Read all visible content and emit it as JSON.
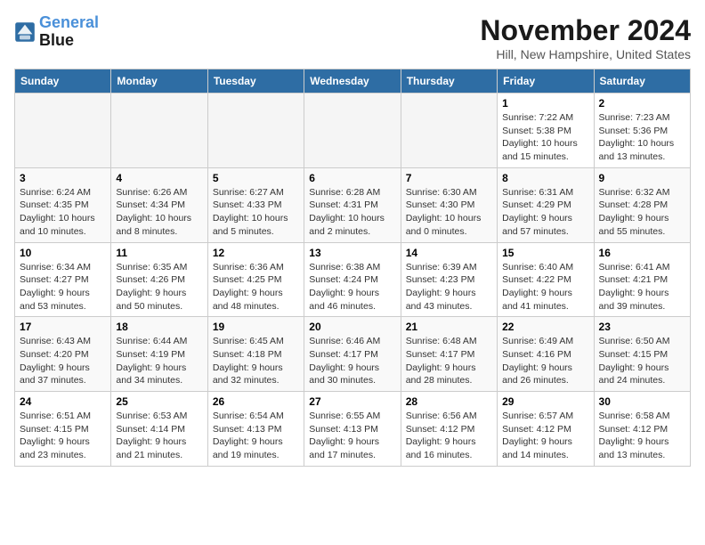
{
  "header": {
    "logo_line1": "General",
    "logo_line2": "Blue",
    "month": "November 2024",
    "location": "Hill, New Hampshire, United States"
  },
  "weekdays": [
    "Sunday",
    "Monday",
    "Tuesday",
    "Wednesday",
    "Thursday",
    "Friday",
    "Saturday"
  ],
  "weeks": [
    [
      {
        "day": "",
        "info": ""
      },
      {
        "day": "",
        "info": ""
      },
      {
        "day": "",
        "info": ""
      },
      {
        "day": "",
        "info": ""
      },
      {
        "day": "",
        "info": ""
      },
      {
        "day": "1",
        "info": "Sunrise: 7:22 AM\nSunset: 5:38 PM\nDaylight: 10 hours\nand 15 minutes."
      },
      {
        "day": "2",
        "info": "Sunrise: 7:23 AM\nSunset: 5:36 PM\nDaylight: 10 hours\nand 13 minutes."
      }
    ],
    [
      {
        "day": "3",
        "info": "Sunrise: 6:24 AM\nSunset: 4:35 PM\nDaylight: 10 hours\nand 10 minutes."
      },
      {
        "day": "4",
        "info": "Sunrise: 6:26 AM\nSunset: 4:34 PM\nDaylight: 10 hours\nand 8 minutes."
      },
      {
        "day": "5",
        "info": "Sunrise: 6:27 AM\nSunset: 4:33 PM\nDaylight: 10 hours\nand 5 minutes."
      },
      {
        "day": "6",
        "info": "Sunrise: 6:28 AM\nSunset: 4:31 PM\nDaylight: 10 hours\nand 2 minutes."
      },
      {
        "day": "7",
        "info": "Sunrise: 6:30 AM\nSunset: 4:30 PM\nDaylight: 10 hours\nand 0 minutes."
      },
      {
        "day": "8",
        "info": "Sunrise: 6:31 AM\nSunset: 4:29 PM\nDaylight: 9 hours\nand 57 minutes."
      },
      {
        "day": "9",
        "info": "Sunrise: 6:32 AM\nSunset: 4:28 PM\nDaylight: 9 hours\nand 55 minutes."
      }
    ],
    [
      {
        "day": "10",
        "info": "Sunrise: 6:34 AM\nSunset: 4:27 PM\nDaylight: 9 hours\nand 53 minutes."
      },
      {
        "day": "11",
        "info": "Sunrise: 6:35 AM\nSunset: 4:26 PM\nDaylight: 9 hours\nand 50 minutes."
      },
      {
        "day": "12",
        "info": "Sunrise: 6:36 AM\nSunset: 4:25 PM\nDaylight: 9 hours\nand 48 minutes."
      },
      {
        "day": "13",
        "info": "Sunrise: 6:38 AM\nSunset: 4:24 PM\nDaylight: 9 hours\nand 46 minutes."
      },
      {
        "day": "14",
        "info": "Sunrise: 6:39 AM\nSunset: 4:23 PM\nDaylight: 9 hours\nand 43 minutes."
      },
      {
        "day": "15",
        "info": "Sunrise: 6:40 AM\nSunset: 4:22 PM\nDaylight: 9 hours\nand 41 minutes."
      },
      {
        "day": "16",
        "info": "Sunrise: 6:41 AM\nSunset: 4:21 PM\nDaylight: 9 hours\nand 39 minutes."
      }
    ],
    [
      {
        "day": "17",
        "info": "Sunrise: 6:43 AM\nSunset: 4:20 PM\nDaylight: 9 hours\nand 37 minutes."
      },
      {
        "day": "18",
        "info": "Sunrise: 6:44 AM\nSunset: 4:19 PM\nDaylight: 9 hours\nand 34 minutes."
      },
      {
        "day": "19",
        "info": "Sunrise: 6:45 AM\nSunset: 4:18 PM\nDaylight: 9 hours\nand 32 minutes."
      },
      {
        "day": "20",
        "info": "Sunrise: 6:46 AM\nSunset: 4:17 PM\nDaylight: 9 hours\nand 30 minutes."
      },
      {
        "day": "21",
        "info": "Sunrise: 6:48 AM\nSunset: 4:17 PM\nDaylight: 9 hours\nand 28 minutes."
      },
      {
        "day": "22",
        "info": "Sunrise: 6:49 AM\nSunset: 4:16 PM\nDaylight: 9 hours\nand 26 minutes."
      },
      {
        "day": "23",
        "info": "Sunrise: 6:50 AM\nSunset: 4:15 PM\nDaylight: 9 hours\nand 24 minutes."
      }
    ],
    [
      {
        "day": "24",
        "info": "Sunrise: 6:51 AM\nSunset: 4:15 PM\nDaylight: 9 hours\nand 23 minutes."
      },
      {
        "day": "25",
        "info": "Sunrise: 6:53 AM\nSunset: 4:14 PM\nDaylight: 9 hours\nand 21 minutes."
      },
      {
        "day": "26",
        "info": "Sunrise: 6:54 AM\nSunset: 4:13 PM\nDaylight: 9 hours\nand 19 minutes."
      },
      {
        "day": "27",
        "info": "Sunrise: 6:55 AM\nSunset: 4:13 PM\nDaylight: 9 hours\nand 17 minutes."
      },
      {
        "day": "28",
        "info": "Sunrise: 6:56 AM\nSunset: 4:12 PM\nDaylight: 9 hours\nand 16 minutes."
      },
      {
        "day": "29",
        "info": "Sunrise: 6:57 AM\nSunset: 4:12 PM\nDaylight: 9 hours\nand 14 minutes."
      },
      {
        "day": "30",
        "info": "Sunrise: 6:58 AM\nSunset: 4:12 PM\nDaylight: 9 hours\nand 13 minutes."
      }
    ]
  ]
}
